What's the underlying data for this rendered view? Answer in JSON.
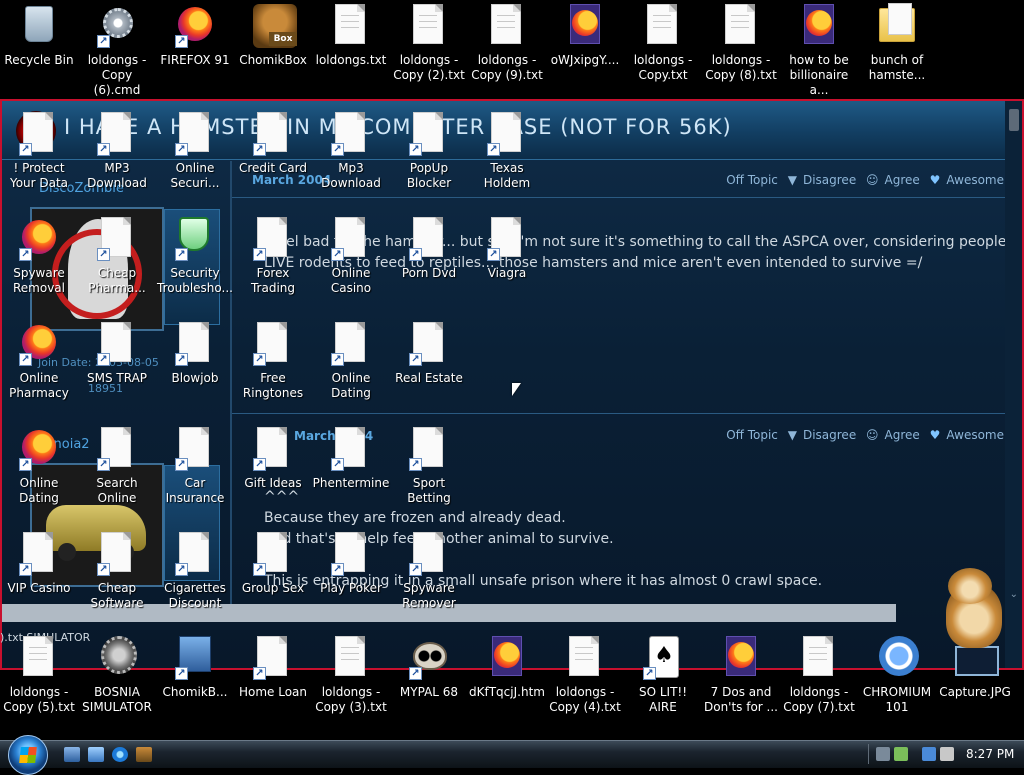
{
  "desktop": {
    "icons_top_row": [
      {
        "label": "Recycle Bin",
        "icon": "recycle-bin"
      },
      {
        "label": "loldongs - Copy (6).cmd",
        "icon": "cmd-gear"
      },
      {
        "label": "FIREFOX 91",
        "icon": "firefox"
      },
      {
        "label": "ChomikBox",
        "icon": "chomikbox"
      },
      {
        "label": "loldongs.txt",
        "icon": "text-file"
      },
      {
        "label": "loldongs - Copy (2).txt",
        "icon": "text-file"
      },
      {
        "label": "loldongs - Copy (9).txt",
        "icon": "text-file"
      },
      {
        "label": "oWJxipgY....",
        "icon": "firefox-html"
      },
      {
        "label": "loldongs - Copy.txt",
        "icon": "text-file"
      },
      {
        "label": "loldongs - Copy (8).txt",
        "icon": "text-file"
      },
      {
        "label": "how to be billionaire a...",
        "icon": "firefox-html"
      },
      {
        "label": "bunch of hamste...",
        "icon": "folder"
      }
    ],
    "icons_grid": [
      {
        "label": "! Protect Your Data",
        "icon": "shortcut"
      },
      {
        "label": "MP3 Download",
        "icon": "shortcut"
      },
      {
        "label": "Online Securi...",
        "icon": "shortcut"
      },
      {
        "label": "Credit Card",
        "icon": "shortcut"
      },
      {
        "label": "Mp3 Download",
        "icon": "shortcut"
      },
      {
        "label": "PopUp Blocker",
        "icon": "shortcut"
      },
      {
        "label": "Texas Holdem",
        "icon": "shortcut"
      },
      {
        "label": "Spyware Removal",
        "icon": "firefox-shortcut"
      },
      {
        "label": "Cheap Pharma...",
        "icon": "shortcut"
      },
      {
        "label": "Security Troublesho...",
        "icon": "shield"
      },
      {
        "label": "Forex Trading",
        "icon": "shortcut"
      },
      {
        "label": "Online Casino",
        "icon": "shortcut"
      },
      {
        "label": "Porn Dvd",
        "icon": "shortcut"
      },
      {
        "label": "Viagra",
        "icon": "shortcut"
      },
      {
        "label": "Online Pharmacy",
        "icon": "firefox-shortcut"
      },
      {
        "label": "SMS TRAP",
        "icon": "shortcut"
      },
      {
        "label": "Blowjob",
        "icon": "shortcut"
      },
      {
        "label": "Free Ringtones",
        "icon": "shortcut"
      },
      {
        "label": "Online Dating",
        "icon": "shortcut"
      },
      {
        "label": "Real Estate",
        "icon": "shortcut"
      },
      {
        "label": "Online Dating",
        "icon": "firefox-shortcut"
      },
      {
        "label": "Search Online",
        "icon": "shortcut"
      },
      {
        "label": "Car Insurance",
        "icon": "shortcut"
      },
      {
        "label": "Gift Ideas",
        "icon": "shortcut"
      },
      {
        "label": "Phentermine",
        "icon": "shortcut"
      },
      {
        "label": "Sport Betting",
        "icon": "shortcut"
      },
      {
        "label": "VIP Casino",
        "icon": "shortcut"
      },
      {
        "label": "Cheap Software",
        "icon": "shortcut"
      },
      {
        "label": "Cigarettes Discount",
        "icon": "shortcut"
      },
      {
        "label": "Group Sex",
        "icon": "shortcut"
      },
      {
        "label": "Play Poker",
        "icon": "shortcut"
      },
      {
        "label": "Spyware Remover",
        "icon": "shortcut"
      }
    ],
    "icons_bottom_row": [
      {
        "label": "loldongs - Copy (5).txt",
        "icon": "text-file"
      },
      {
        "label": "BOSNIA SIMULATOR",
        "icon": "bosnia"
      },
      {
        "label": "ChomikB...",
        "icon": "installer"
      },
      {
        "label": "Home Loan",
        "icon": "shortcut"
      },
      {
        "label": "loldongs - Copy (3).txt",
        "icon": "text-file"
      },
      {
        "label": "MYPAL 68",
        "icon": "raccoon"
      },
      {
        "label": "dKfTqcjJ.htm",
        "icon": "firefox-html"
      },
      {
        "label": "loldongs - Copy (4).txt",
        "icon": "text-file"
      },
      {
        "label": "SO LIT!! AIRE",
        "icon": "cards"
      },
      {
        "label": "7 Dos and Don'ts for ...",
        "icon": "firefox-html"
      },
      {
        "label": "loldongs - Copy (7).txt",
        "icon": "text-file"
      },
      {
        "label": "CHROMIUM 101",
        "icon": "chromium"
      },
      {
        "label": "Capture.JPG",
        "icon": "jpg"
      }
    ]
  },
  "browser": {
    "site_title": "I HAVE A HAMSTER IN MY COMPUTER CASE (NOT FOR 56K)",
    "posts": [
      {
        "date": "March 2004",
        "username": "DiscoZombie",
        "meta_line1": "Join Date: 2003-08-05",
        "meta_line2": "18951",
        "actions": [
          "Off Topic",
          "Disagree",
          "Agree",
          "Awesome"
        ],
        "lines": [
          "I feel bad for the hamster... but still I'm not sure it's something to call the ASPCA over, considering people buy",
          "LIVE rodents to feed to reptiles... those hamsters and mice aren't even intended to survive =/"
        ]
      },
      {
        "date": "March 2004",
        "username": "paranoia2",
        "actions": [
          "Off Topic",
          "Disagree",
          "Agree",
          "Awesome"
        ],
        "lines": [
          "^^^",
          "Because they are frozen and already dead.",
          "And that's to help feed another animal to survive.",
          "This is entrapping it in a small unsafe prison where it has almost 0 crawl space."
        ]
      }
    ],
    "bottom_fragment": ").txt    SIMULATOR"
  },
  "taskbar": {
    "clock": "8:27 PM"
  }
}
